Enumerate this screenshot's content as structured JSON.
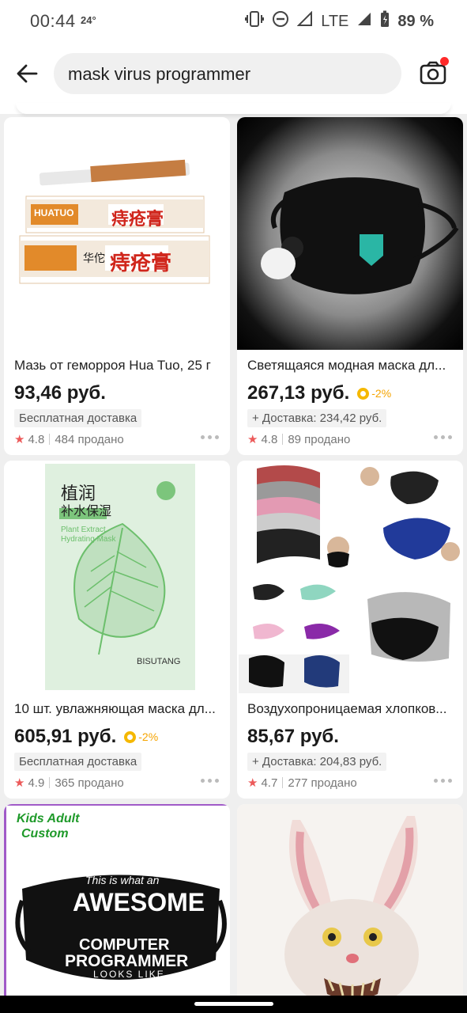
{
  "status_bar": {
    "time": "00:44",
    "temperature": "24°",
    "network": "LTE",
    "battery": "89 %"
  },
  "search": {
    "query": "mask virus programmer"
  },
  "products": [
    {
      "title": "Мазь от геморроя Hua Tuo, 25 г",
      "price": "93,46 руб.",
      "discount": "",
      "shipping": "Бесплатная доставка",
      "rating": "4.8",
      "sold": "484 продано",
      "image_text": [
        "HUATUO",
        "痔疮膏",
        "华佗",
        "痔疮膏"
      ]
    },
    {
      "title": "Светящаяся модная маска дл...",
      "price": "267,13 руб.",
      "discount": "-2%",
      "shipping": "+ Доставка: 234,42 руб.",
      "rating": "4.8",
      "sold": "89 продано",
      "image_text": []
    },
    {
      "title": "10 шт. увлажняющая маска дл...",
      "price": "605,91 руб.",
      "discount": "-2%",
      "shipping": "Бесплатная доставка",
      "rating": "4.9",
      "sold": "365 продано",
      "image_text": [
        "植润",
        "补水保湿",
        "Plant Extract",
        "Hydrating Mask",
        "BISUTANG"
      ]
    },
    {
      "title": "Воздухопроницаемая хлопков...",
      "price": "85,67 руб.",
      "discount": "",
      "shipping": "+ Доставка: 204,83 руб.",
      "rating": "4.7",
      "sold": "277 продано",
      "image_text": []
    },
    {
      "title": "",
      "image_text": [
        "Kids Adult",
        "Custom",
        "This is what an",
        "AWESOME",
        "COMPUTER",
        "PROGRAMMER",
        "LOOKS LIKE"
      ]
    },
    {
      "title": "",
      "image_text": []
    }
  ],
  "colors": {
    "accent_red": "#ff2a2a",
    "star": "#ec5a5a",
    "coin": "#f5b800",
    "green_text": "#1f9a2a"
  }
}
